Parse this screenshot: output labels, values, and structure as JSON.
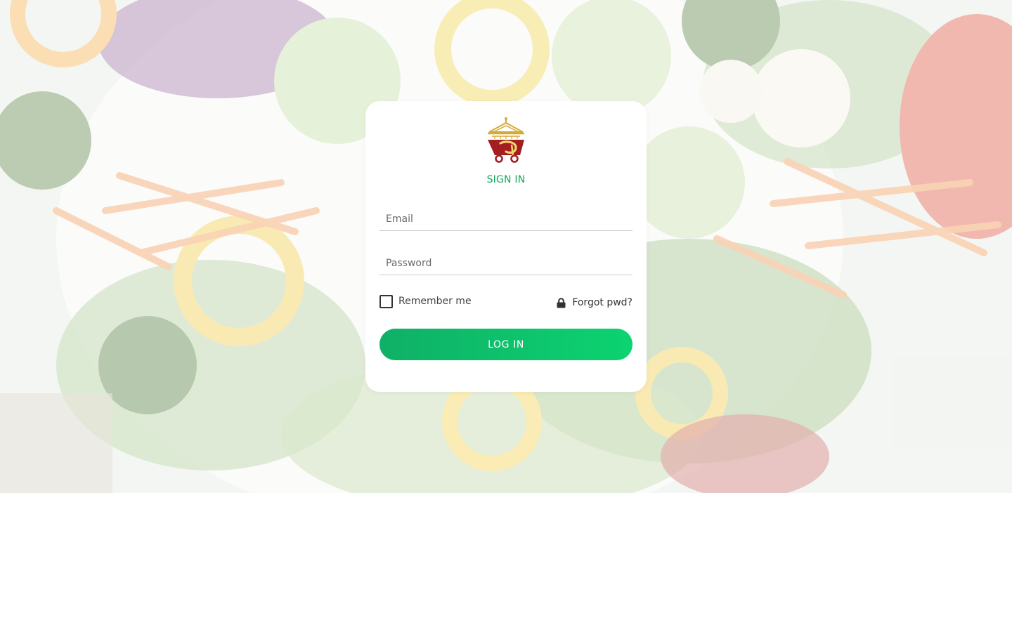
{
  "background": {
    "image": "fresh-vegetable-salad-photo",
    "overlay_color": "#ffffff"
  },
  "brand": {
    "logo": "temple-cart-logo",
    "logo_colors": [
      "#d4a937",
      "#a31e23"
    ]
  },
  "login": {
    "title": "SIGN IN",
    "email_placeholder": "Email",
    "password_placeholder": "Password",
    "remember_label": "Remember me",
    "remember_checked": false,
    "forgot_icon": "lock-icon",
    "forgot_label": "Forgot pwd?",
    "submit_label": "LOG IN"
  },
  "colors": {
    "accent": "#16a75c",
    "button_gradient_start": "#0fb066",
    "button_gradient_end": "#0cd371"
  }
}
